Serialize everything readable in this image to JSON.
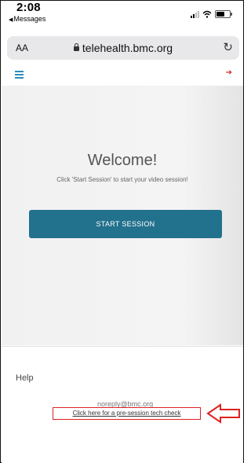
{
  "status_bar": {
    "time": "2:08",
    "back_app": "Messages"
  },
  "browser": {
    "text_size_label": "AA",
    "url": "telehealth.bmc.org"
  },
  "main": {
    "welcome": "Welcome!",
    "subtitle": "Click 'Start Session' to start your video session!",
    "start_button": "START SESSION"
  },
  "footer": {
    "help": "Help",
    "email": "noreply@bmc.org",
    "tech_check_link": "Click here for a pre-session tech check"
  },
  "colors": {
    "primary_button": "#22718d",
    "menu_icon": "#2a8fb8",
    "signout_icon": "#cc2a2a",
    "annotation": "#dd2222"
  }
}
